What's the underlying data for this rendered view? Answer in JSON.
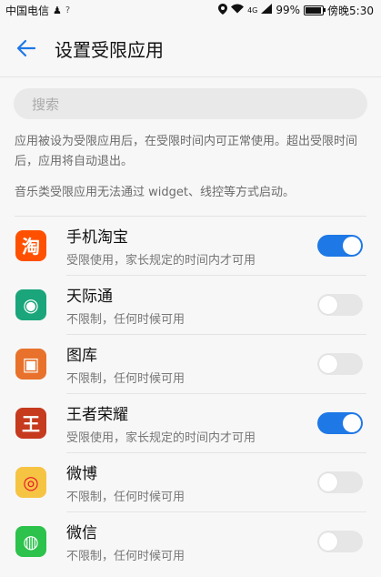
{
  "status_bar": {
    "carrier": "中国电信",
    "battery_percent": "99%",
    "time": "傍晚5:30",
    "network": "4G"
  },
  "header": {
    "title": "设置受限应用"
  },
  "search": {
    "placeholder": "搜索"
  },
  "description": {
    "line1": "应用被设为受限应用后，在受限时间内可正常使用。超出受限时间后，应用将自动退出。",
    "line2": "音乐类受限应用无法通过 widget、线控等方式启动。"
  },
  "apps": [
    {
      "name": "手机淘宝",
      "subtitle": "受限使用，家长规定的时间内才可用",
      "restricted": true,
      "icon": "taobao-icon",
      "color": "#ff5000"
    },
    {
      "name": "天际通",
      "subtitle": "不限制，任何时候可用",
      "restricted": false,
      "icon": "tianjitong-icon",
      "color": "#1aa57a"
    },
    {
      "name": "图库",
      "subtitle": "不限制，任何时候可用",
      "restricted": false,
      "icon": "gallery-icon",
      "color": "#e8722b"
    },
    {
      "name": "王者荣耀",
      "subtitle": "受限使用，家长规定的时间内才可用",
      "restricted": true,
      "icon": "honor-of-kings-icon",
      "color": "#c63a1e"
    },
    {
      "name": "微博",
      "subtitle": "不限制，任何时候可用",
      "restricted": false,
      "icon": "weibo-icon",
      "color": "#f6c443"
    },
    {
      "name": "微信",
      "subtitle": "不限制，任何时候可用",
      "restricted": false,
      "icon": "wechat-icon",
      "color": "#2cc24c"
    }
  ]
}
